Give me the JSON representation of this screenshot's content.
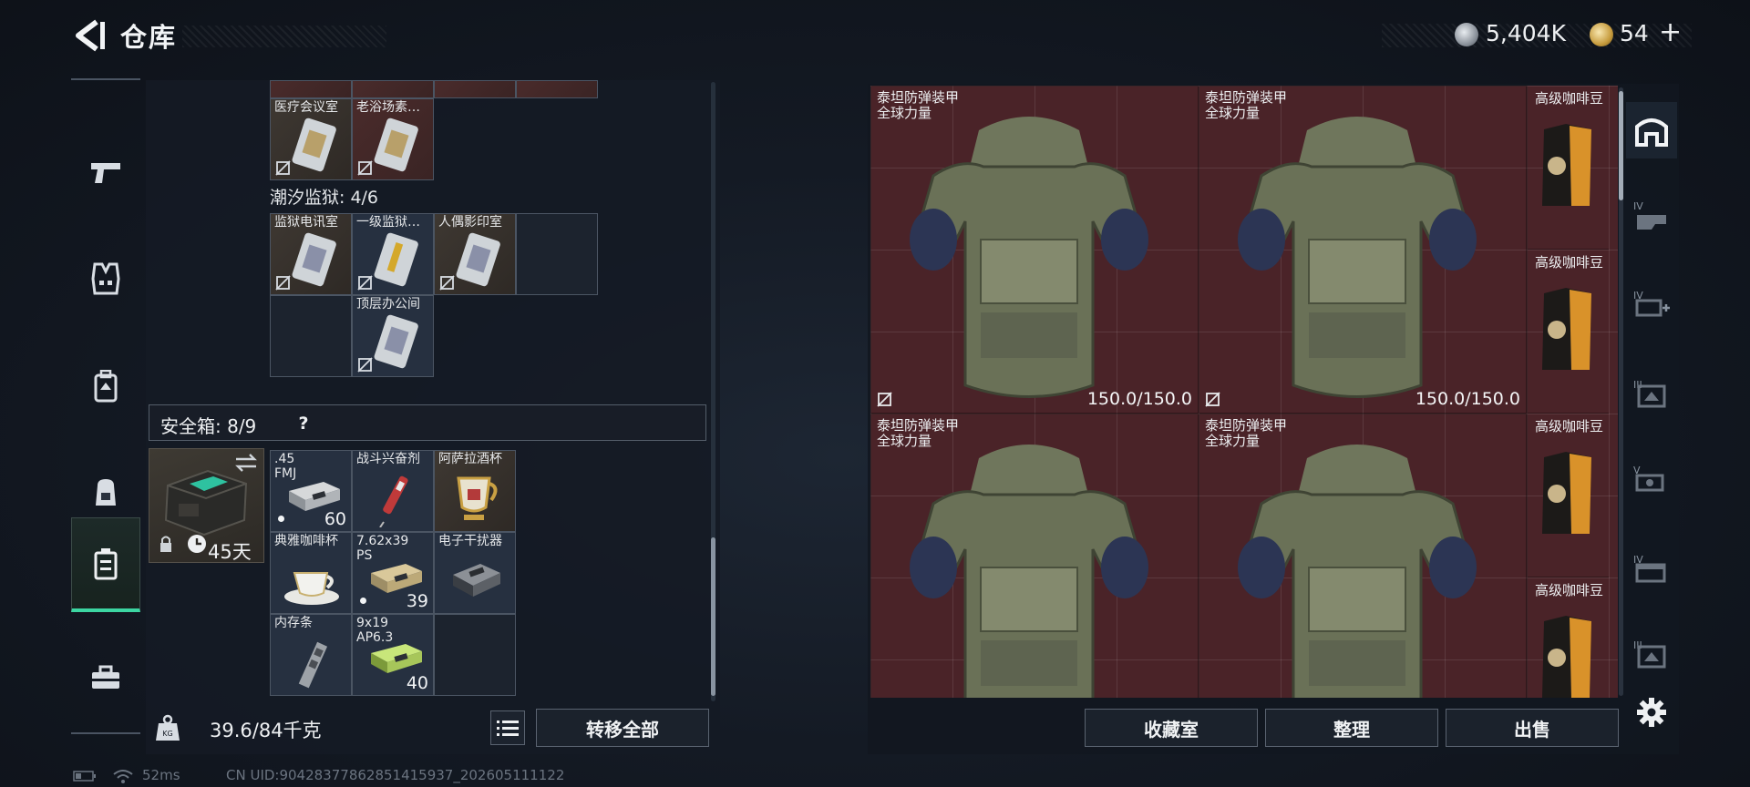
{
  "header": {
    "title": "仓库",
    "currency": {
      "silver": "5,404K",
      "gold": "54",
      "plus": "+"
    }
  },
  "left_nav": [
    "weapons-icon",
    "armor-icon",
    "backpack-rig-icon",
    "backpack-icon",
    "safe-case-icon",
    "toolbox-icon"
  ],
  "rig": {
    "row1": [
      "医疗会议室",
      "老浴场素…"
    ],
    "section_label": "潮汐监狱: 4/6",
    "row2": [
      "监狱电讯室",
      "一级监狱…",
      "人偶影印室"
    ],
    "row3": [
      "顶层办公间"
    ]
  },
  "safe": {
    "title": "安全箱: 8/9",
    "help": "?",
    "days": "45天",
    "items": [
      {
        "label": ".45\nFMJ",
        "count": "60"
      },
      {
        "label": "战斗兴奋剂",
        "count": ""
      },
      {
        "label": "阿萨拉酒杯",
        "count": ""
      },
      {
        "label": "典雅咖啡杯",
        "count": ""
      },
      {
        "label": "7.62x39\nPS",
        "count": "39"
      },
      {
        "label": "电子干扰器",
        "count": ""
      },
      {
        "label": "内存条",
        "count": ""
      },
      {
        "label": "9x19\nAP6.3",
        "count": "40"
      }
    ]
  },
  "capacity": {
    "weight": "39.6/84千克",
    "transfer_all": "转移全部"
  },
  "stash": {
    "armor": [
      {
        "name": "泰坦防弹装甲",
        "sub": "全球力量",
        "durability": "150.0/150.0"
      },
      {
        "name": "泰坦防弹装甲",
        "sub": "全球力量",
        "durability": "150.0/150.0"
      },
      {
        "name": "泰坦防弹装甲",
        "sub": "全球力量",
        "durability": ""
      },
      {
        "name": "泰坦防弹装甲",
        "sub": "全球力量",
        "durability": ""
      }
    ],
    "coffee": [
      "高级咖啡豆",
      "高级咖啡豆",
      "高级咖啡豆",
      "高级咖啡豆"
    ],
    "buttons": {
      "collection": "收藏室",
      "organize": "整理",
      "sell": "出售"
    }
  },
  "right_icons": [
    "stash-home-icon",
    "filter-iv-icon",
    "filter-iv-plus-icon",
    "filter-iii-icon",
    "filter-v-icon",
    "filter-iv-b-icon",
    "filter-iii-b-icon"
  ],
  "footer": {
    "ping": "52ms",
    "uid": "CN UID:9042837786285141593​7_202605111122"
  },
  "colors": {
    "accent": "#3cd6a2",
    "stash_bg": "#4a2328",
    "panel": "#141a24"
  }
}
